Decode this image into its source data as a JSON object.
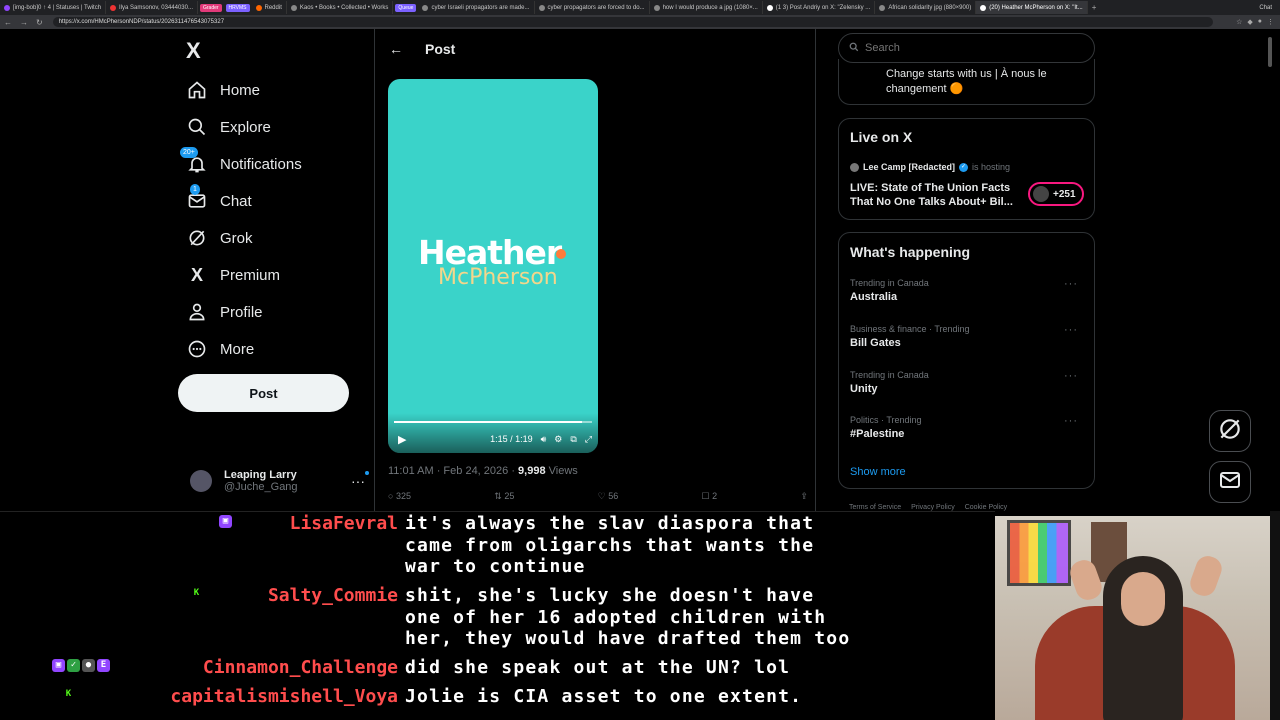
{
  "browser": {
    "tabs": [
      {
        "label": "[img-bob]0 ↑ 4 | Statuses | Twitch",
        "color": "#9146ff",
        "active": false
      },
      {
        "label": "Ilya Samsonov, 03444030...",
        "color": "#e33",
        "active": false
      },
      {
        "label": "Reddit",
        "color": "#f60",
        "active": false
      },
      {
        "label": "Kaos • Books • Collected • Works",
        "color": "#888",
        "active": false
      },
      {
        "label": "cyber Israeli propagators are made...",
        "color": "#888",
        "active": false
      },
      {
        "label": "cyber propagators are forced to do...",
        "color": "#888",
        "active": false
      },
      {
        "label": "how I would produce a jpg (1080×...",
        "color": "#888",
        "active": false
      },
      {
        "label": "(1 3) Post Andriy on X: \"Zelensky ...",
        "color": "#fff",
        "active": false
      },
      {
        "label": "African solidarity jpg (880×900)",
        "color": "#888",
        "active": false
      },
      {
        "label": "(20) Heather McPherson on X: \"It...",
        "color": "#fff",
        "active": true
      }
    ],
    "pills": [
      "Grader",
      "HRVMS",
      "Queue"
    ],
    "url": "https://x.com/HMcPhersonNDP/status/2026311476543075327",
    "right_label": "Chat"
  },
  "leftnav": {
    "logo": "X",
    "items": [
      {
        "label": "Home",
        "icon": "home-icon"
      },
      {
        "label": "Explore",
        "icon": "search-icon"
      },
      {
        "label": "Notifications",
        "icon": "bell-icon",
        "badge": "20+"
      },
      {
        "label": "Chat",
        "icon": "mail-icon",
        "badge": "1"
      },
      {
        "label": "Grok",
        "icon": "grok-icon"
      },
      {
        "label": "Premium",
        "icon": "x-logo-icon"
      },
      {
        "label": "Profile",
        "icon": "person-icon"
      },
      {
        "label": "More",
        "icon": "more-circle-icon"
      }
    ],
    "post_label": "Post",
    "account": {
      "name": "Leaping Larry",
      "handle": "@Juche_Gang"
    }
  },
  "main": {
    "header_title": "Post",
    "video": {
      "title_line1": "Heather",
      "title_line2": "McPherson",
      "time": "1:15 / 1:19",
      "progress": 0.95,
      "bg_color": "#3ad3c9"
    },
    "meta": {
      "time": "11:01 AM · Feb 24, 2026 · ",
      "views_count": "9,998",
      "views_label": " Views"
    },
    "actions": [
      "325",
      "25",
      "56",
      "2"
    ]
  },
  "right": {
    "search_placeholder": "Search",
    "promo_text": "Change starts with us | À nous le changement 🟠",
    "live": {
      "title": "Live on X",
      "host_name": "Lee Camp [Redacted]",
      "hosting": "is hosting",
      "stream_title": "LIVE: State of The Union Facts That No One Talks About+ Bil...",
      "count": "+251"
    },
    "happening": {
      "title": "What's happening",
      "trends": [
        {
          "context": "Trending in Canada",
          "name": "Australia"
        },
        {
          "context": "Business & finance · Trending",
          "name": "Bill Gates"
        },
        {
          "context": "Trending in Canada",
          "name": "Unity"
        },
        {
          "context": "Politics · Trending",
          "name": "#Palestine"
        }
      ],
      "show_more": "Show more"
    },
    "footer": [
      "Terms of Service",
      "Privacy Policy",
      "Cookie Policy"
    ]
  },
  "chat": {
    "messages": [
      {
        "user": "LisaFevral",
        "color": "#ff4d4d",
        "badges": [
          {
            "t": "▣",
            "c": "#9146ff"
          }
        ],
        "text": "it's always the slav diaspora that\ncame from oligarchs that wants the\nwar to continue"
      },
      {
        "user": "Salty_Commie",
        "color": "#ff4d4d",
        "badges": [
          {
            "t": "K",
            "c": "#53fc18"
          }
        ],
        "text": "shit, she's lucky she doesn't have\none of her 16 adopted children with\nher, they would have drafted them too"
      },
      {
        "user": "Cinnamon_Challenge",
        "color": "#ff4d4d",
        "badges": [
          {
            "t": "▣",
            "c": "#9146ff"
          },
          {
            "t": "✓",
            "c": "#2ea043"
          },
          {
            "t": "●",
            "c": "#555"
          },
          {
            "t": "E",
            "c": "#9146ff"
          }
        ],
        "text": "did she speak out at the UN? lol"
      },
      {
        "user": "capitalismishell_Voya",
        "color": "#ff4d4d",
        "badges": [
          {
            "t": "K",
            "c": "#53fc18"
          }
        ],
        "text": "Jolie is CIA asset to one extent."
      }
    ]
  }
}
